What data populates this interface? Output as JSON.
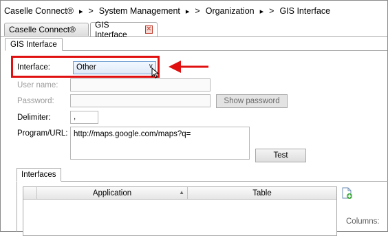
{
  "breadcrumb": [
    {
      "label": "Caselle Connect®"
    },
    {
      "label": "System Management"
    },
    {
      "label": "Organization"
    },
    {
      "label": "GIS Interface"
    }
  ],
  "crumb_arrow": "▸",
  "crumb_sep": ">",
  "tabs": [
    {
      "label": "Caselle Connect®",
      "active": false
    },
    {
      "label": "GIS Interface",
      "active": true,
      "close_glyph": "✕"
    }
  ],
  "panel": {
    "tab_label": "GIS Interface",
    "interface": {
      "label": "Interface:",
      "value": "Other",
      "chevron": "∨"
    },
    "username": {
      "label": "User name:",
      "value": ""
    },
    "password": {
      "label": "Password:",
      "value": "",
      "show_button": "Show password"
    },
    "delimiter": {
      "label": "Delimiter:",
      "value": ","
    },
    "program_url": {
      "label": "Program/URL:",
      "value": "http://maps.google.com/maps?q="
    },
    "test_button": "Test",
    "interfaces_group": {
      "tab_label": "Interfaces",
      "columns": [
        {
          "label": "Application",
          "sort": "▲"
        },
        {
          "label": "Table"
        }
      ],
      "columns_label": "Columns:"
    }
  },
  "colors": {
    "highlight": "#e01010",
    "select_border": "#6c9bd2"
  }
}
